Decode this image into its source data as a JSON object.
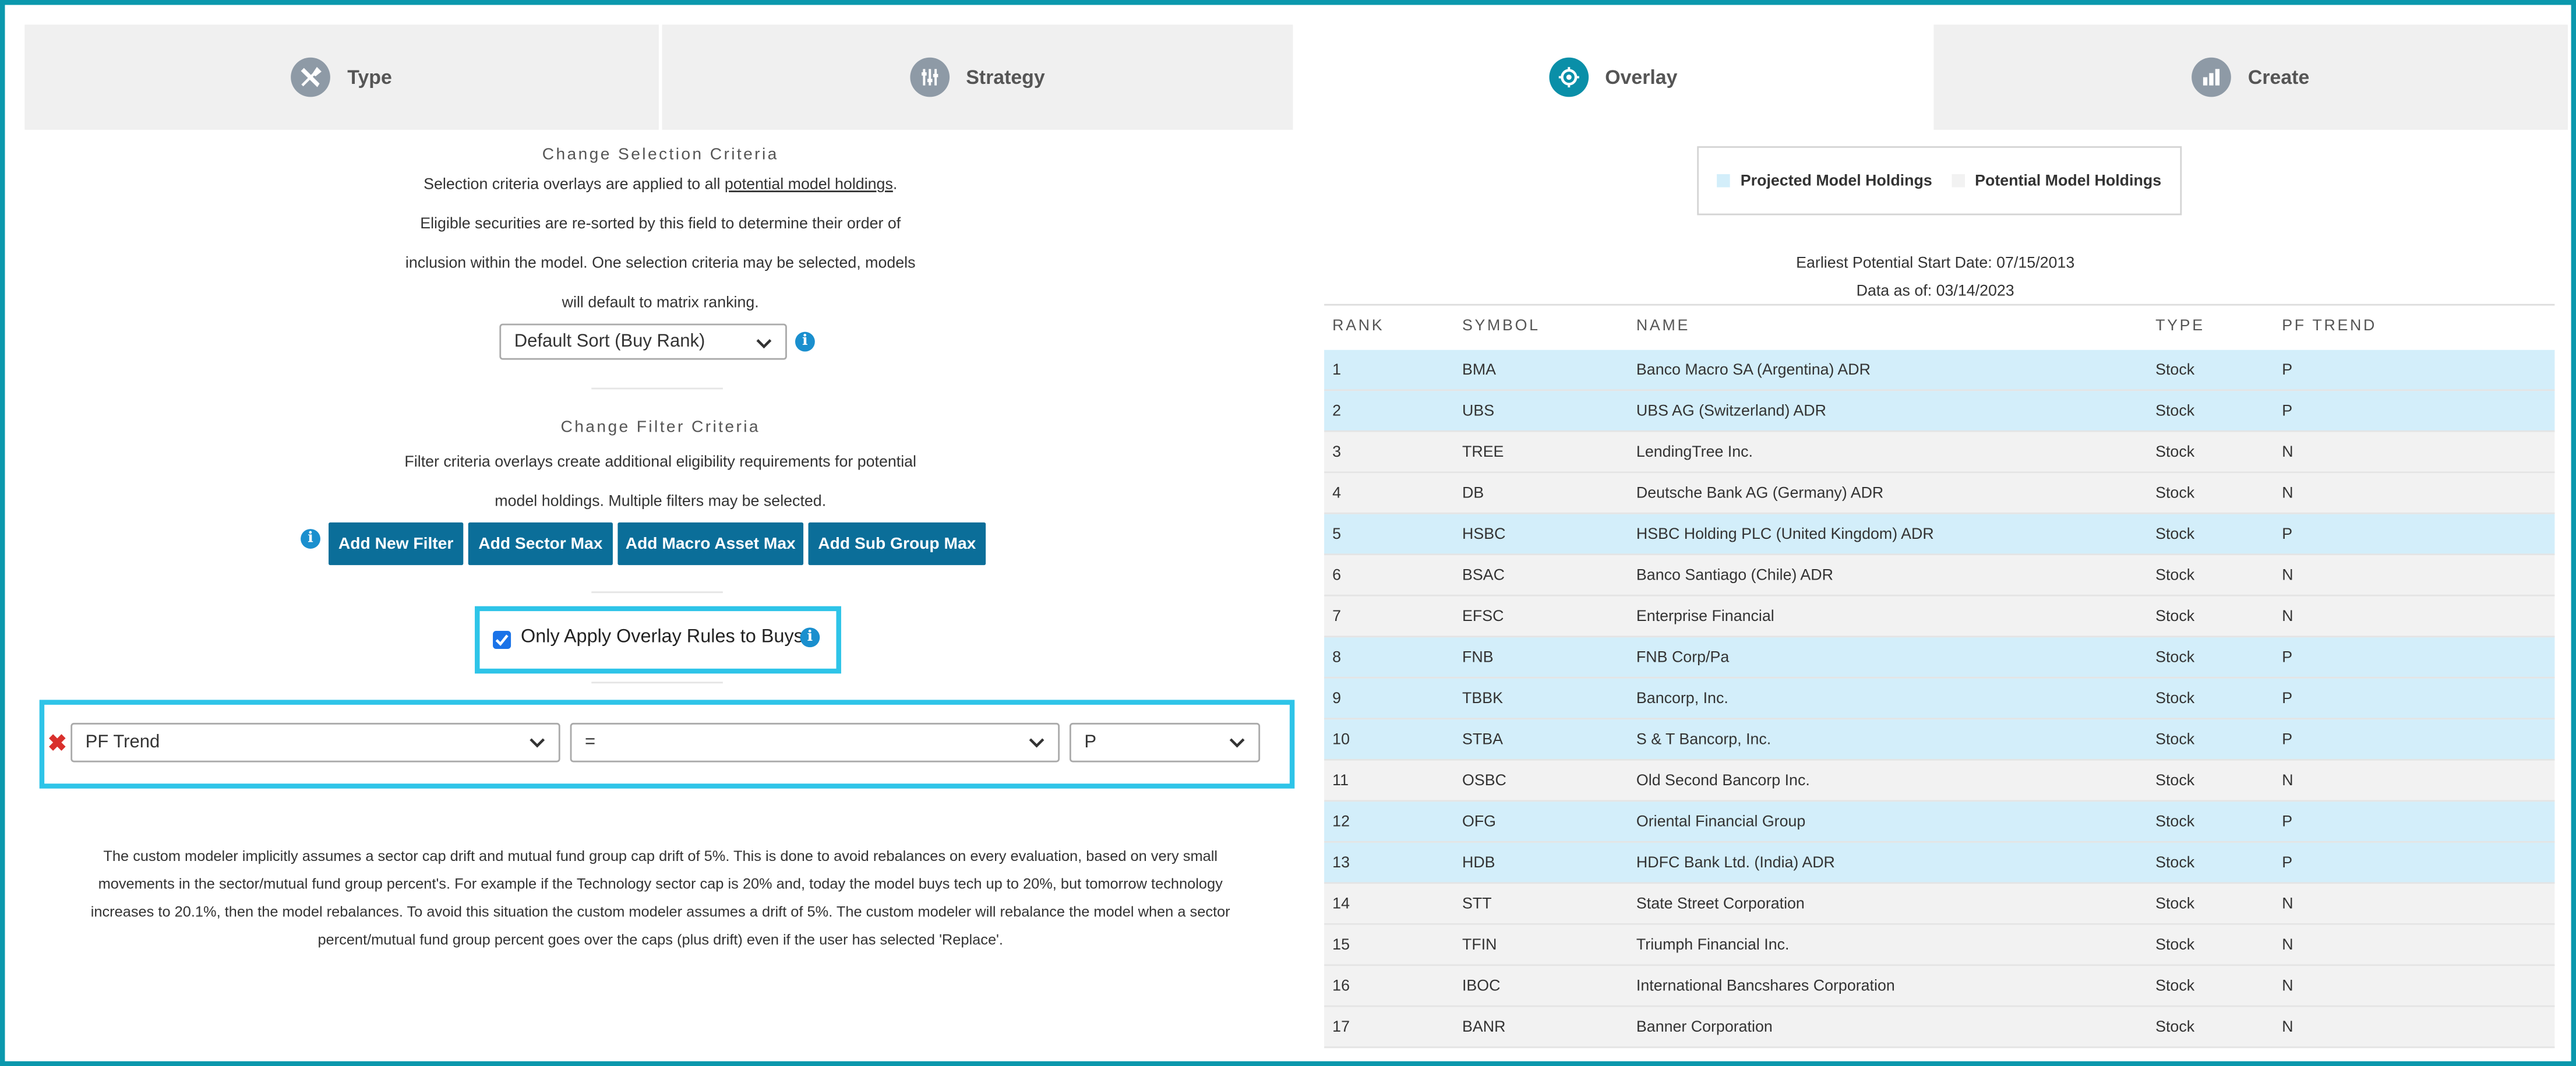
{
  "tabs": [
    {
      "label": "Type",
      "icon": "tools-icon",
      "active": false
    },
    {
      "label": "Strategy",
      "icon": "sliders-icon",
      "active": false
    },
    {
      "label": "Overlay",
      "icon": "overlay-icon",
      "active": true
    },
    {
      "label": "Create",
      "icon": "bar-chart-icon",
      "active": false
    }
  ],
  "selection": {
    "title": "Change Selection Criteria",
    "line1_pre": "Selection criteria overlays are applied to all ",
    "line1_link": "potential model holdings",
    "line1_post": ".",
    "line2": "Eligible securities are re-sorted by this field to determine their order of",
    "line3": "inclusion within the model. One selection criteria may be selected, models",
    "line4": "will default to matrix ranking.",
    "sort_value": "Default Sort (Buy Rank)"
  },
  "filter": {
    "title": "Change Filter Criteria",
    "line1": "Filter criteria overlays create additional eligibility requirements for potential",
    "line2": "model holdings. Multiple filters may be selected.",
    "buttons": [
      "Add New Filter",
      "Add Sector Max",
      "Add Macro Asset Max",
      "Add Sub Group Max"
    ]
  },
  "overlay_buys": {
    "label": "Only Apply Overlay Rules to Buys",
    "checked": true
  },
  "filter_row": {
    "field": "PF Trend",
    "operator": "=",
    "value": "P"
  },
  "disclaimer": {
    "line1": "The custom modeler implicitly assumes a sector cap drift and mutual fund group cap drift of 5%. This is done to avoid rebalances on every evaluation, based on very small",
    "line2": "movements in the sector/mutual fund group percent's. For example if the Technology sector cap is 20% and, today the model buys tech up to 20%, but tomorrow technology",
    "line3": "increases to 20.1%, then the model rebalances. To avoid this situation the custom modeler assumes a drift of 5%. The custom modeler will rebalance the model when a sector",
    "line4": "percent/mutual fund group percent goes over the caps (plus drift) even if the user has selected 'Replace'."
  },
  "legend": {
    "projected": "Projected Model Holdings",
    "potential": "Potential Model Holdings",
    "projected_color": "#d3eefa",
    "potential_color": "#f2f2f2"
  },
  "meta": {
    "start_date": "Earliest Potential Start Date: 07/15/2013",
    "data_as_of": "Data as of: 03/14/2023"
  },
  "table": {
    "headers": {
      "rank": "RANK",
      "symbol": "SYMBOL",
      "name": "NAME",
      "type": "TYPE",
      "trend": "PF TREND"
    },
    "rows": [
      {
        "rank": "1",
        "symbol": "BMA",
        "name": "Banco Macro SA (Argentina) ADR",
        "type": "Stock",
        "trend": "P",
        "projected": true
      },
      {
        "rank": "2",
        "symbol": "UBS",
        "name": "UBS AG (Switzerland) ADR",
        "type": "Stock",
        "trend": "P",
        "projected": true
      },
      {
        "rank": "3",
        "symbol": "TREE",
        "name": "LendingTree Inc.",
        "type": "Stock",
        "trend": "N",
        "projected": false
      },
      {
        "rank": "4",
        "symbol": "DB",
        "name": "Deutsche Bank AG (Germany) ADR",
        "type": "Stock",
        "trend": "N",
        "projected": false
      },
      {
        "rank": "5",
        "symbol": "HSBC",
        "name": "HSBC Holding PLC (United Kingdom) ADR",
        "type": "Stock",
        "trend": "P",
        "projected": true
      },
      {
        "rank": "6",
        "symbol": "BSAC",
        "name": "Banco Santiago (Chile) ADR",
        "type": "Stock",
        "trend": "N",
        "projected": false
      },
      {
        "rank": "7",
        "symbol": "EFSC",
        "name": "Enterprise Financial",
        "type": "Stock",
        "trend": "N",
        "projected": false
      },
      {
        "rank": "8",
        "symbol": "FNB",
        "name": "FNB Corp/Pa",
        "type": "Stock",
        "trend": "P",
        "projected": true
      },
      {
        "rank": "9",
        "symbol": "TBBK",
        "name": "Bancorp, Inc.",
        "type": "Stock",
        "trend": "P",
        "projected": true
      },
      {
        "rank": "10",
        "symbol": "STBA",
        "name": "S & T Bancorp, Inc.",
        "type": "Stock",
        "trend": "P",
        "projected": true
      },
      {
        "rank": "11",
        "symbol": "OSBC",
        "name": "Old Second Bancorp Inc.",
        "type": "Stock",
        "trend": "N",
        "projected": false
      },
      {
        "rank": "12",
        "symbol": "OFG",
        "name": "Oriental Financial Group",
        "type": "Stock",
        "trend": "P",
        "projected": true
      },
      {
        "rank": "13",
        "symbol": "HDB",
        "name": "HDFC Bank Ltd. (India) ADR",
        "type": "Stock",
        "trend": "P",
        "projected": true
      },
      {
        "rank": "14",
        "symbol": "STT",
        "name": "State Street Corporation",
        "type": "Stock",
        "trend": "N",
        "projected": false
      },
      {
        "rank": "15",
        "symbol": "TFIN",
        "name": "Triumph Financial Inc.",
        "type": "Stock",
        "trend": "N",
        "projected": false
      },
      {
        "rank": "16",
        "symbol": "IBOC",
        "name": "International Bancshares Corporation",
        "type": "Stock",
        "trend": "N",
        "projected": false
      },
      {
        "rank": "17",
        "symbol": "BANR",
        "name": "Banner Corporation",
        "type": "Stock",
        "trend": "N",
        "projected": false
      }
    ]
  }
}
